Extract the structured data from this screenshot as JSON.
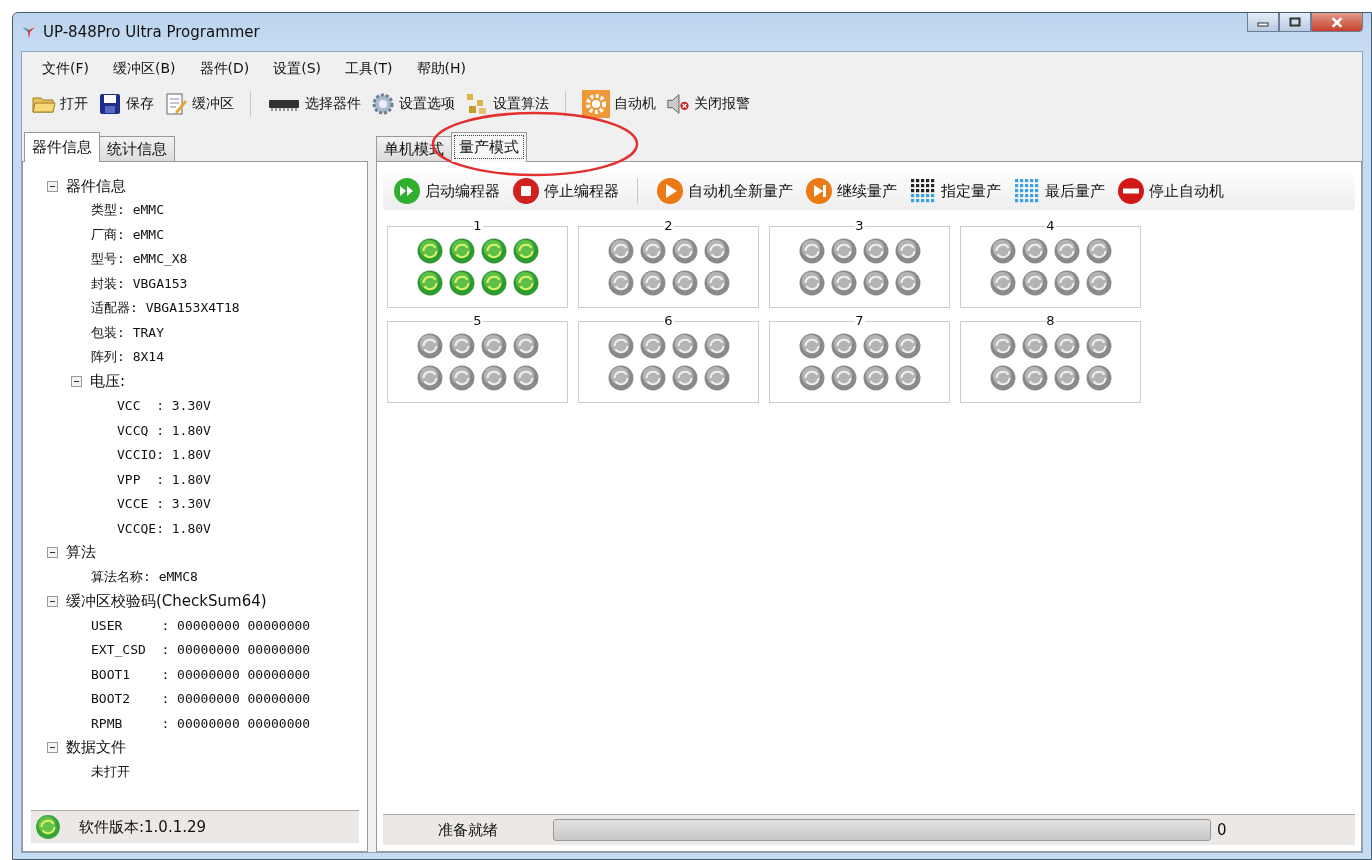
{
  "window": {
    "title": "UP-848Pro Ultra Programmer"
  },
  "menu": [
    "文件(F)",
    "缓冲区(B)",
    "器件(D)",
    "设置(S)",
    "工具(T)",
    "帮助(H)"
  ],
  "toolbar": [
    [
      {
        "label": "打开",
        "kind": "folder"
      },
      {
        "label": "保存",
        "kind": "save"
      },
      {
        "label": "缓冲区",
        "kind": "edit"
      }
    ],
    [
      {
        "label": "选择器件",
        "kind": "chip"
      },
      {
        "label": "设置选项",
        "kind": "gear"
      },
      {
        "label": "设置算法",
        "kind": "blocks"
      }
    ],
    [
      {
        "label": "自动机",
        "kind": "autogear"
      },
      {
        "label": "关闭报警",
        "kind": "speaker"
      }
    ]
  ],
  "left_panel": {
    "tabs": [
      {
        "label": "器件信息",
        "selected": true
      },
      {
        "label": "统计信息",
        "selected": false
      }
    ],
    "tree": [
      {
        "label": "器件信息",
        "expanded": true,
        "children": [
          {
            "label": "类型: eMMC"
          },
          {
            "label": "厂商: eMMC"
          },
          {
            "label": "型号: eMMC_X8"
          },
          {
            "label": "封装: VBGA153"
          },
          {
            "label": "适配器: VBGA153X4T18"
          },
          {
            "label": "包装: TRAY"
          },
          {
            "label": "阵列: 8X14"
          },
          {
            "label": "电压:",
            "expanded": true,
            "children": [
              {
                "label": "VCC  : 3.30V"
              },
              {
                "label": "VCCQ : 1.80V"
              },
              {
                "label": "VCCIO: 1.80V"
              },
              {
                "label": "VPP  : 1.80V"
              },
              {
                "label": "VCCE : 3.30V"
              },
              {
                "label": "VCCQE: 1.80V"
              }
            ]
          }
        ]
      },
      {
        "label": "算法",
        "expanded": true,
        "children": [
          {
            "label": "算法名称: eMMC8"
          }
        ]
      },
      {
        "label": "缓冲区校验码(CheckSum64)",
        "expanded": true,
        "children": [
          {
            "label": "USER     : 00000000 00000000"
          },
          {
            "label": "EXT_CSD  : 00000000 00000000"
          },
          {
            "label": "BOOT1    : 00000000 00000000"
          },
          {
            "label": "BOOT2    : 00000000 00000000"
          },
          {
            "label": "RPMB     : 00000000 00000000"
          }
        ]
      },
      {
        "label": "数据文件",
        "expanded": true,
        "children": [
          {
            "label": "未打开"
          }
        ]
      }
    ],
    "status": "软件版本:1.0.1.29"
  },
  "right_panel": {
    "tabs": [
      {
        "label": "单机模式",
        "selected": false
      },
      {
        "label": "量产模式",
        "selected": true
      }
    ],
    "toolbar": [
      [
        {
          "label": "启动编程器",
          "kind": "start"
        },
        {
          "label": "停止编程器",
          "kind": "stop"
        }
      ],
      [
        {
          "label": "自动机全新量产",
          "kind": "play"
        },
        {
          "label": "继续量产",
          "kind": "skip"
        },
        {
          "label": "指定量产",
          "kind": "grid_dark"
        },
        {
          "label": "最后量产",
          "kind": "grid_blue"
        },
        {
          "label": "停止自动机",
          "kind": "noentry"
        }
      ]
    ],
    "sites": [
      {
        "label": "1",
        "active": true
      },
      {
        "label": "2",
        "active": false
      },
      {
        "label": "3",
        "active": false
      },
      {
        "label": "4",
        "active": false
      },
      {
        "label": "5",
        "active": false
      },
      {
        "label": "6",
        "active": false
      },
      {
        "label": "7",
        "active": false
      },
      {
        "label": "8",
        "active": false
      }
    ],
    "status": {
      "text": "准备就绪",
      "level": 0,
      "reading": "0"
    }
  },
  "annotations": [
    {
      "kind": "ellipse"
    }
  ]
}
